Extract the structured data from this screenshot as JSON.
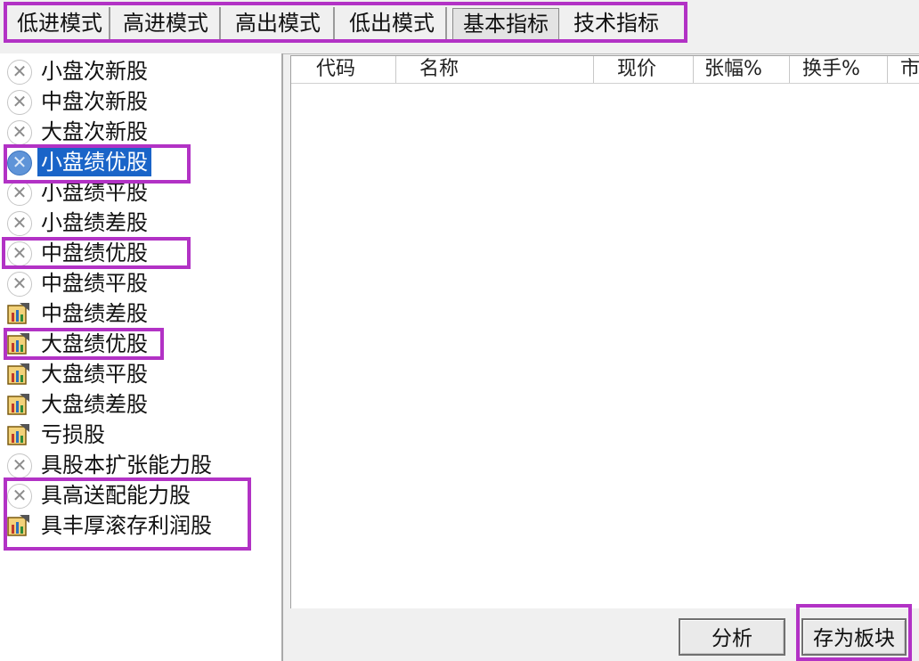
{
  "tabs": [
    {
      "label": "低进模式"
    },
    {
      "label": "高进模式"
    },
    {
      "label": "高出模式"
    },
    {
      "label": "低出模式"
    },
    {
      "label": "基本指标",
      "active": true
    },
    {
      "label": "技术指标"
    }
  ],
  "tree": {
    "items": [
      {
        "label": "小盘次新股",
        "icon": "x-circle-icon"
      },
      {
        "label": "中盘次新股",
        "icon": "x-circle-icon"
      },
      {
        "label": "大盘次新股",
        "icon": "x-circle-icon"
      },
      {
        "label": "小盘绩优股",
        "icon": "x-circle-icon",
        "selected": true
      },
      {
        "label": "小盘绩平股",
        "icon": "x-circle-icon"
      },
      {
        "label": "小盘绩差股",
        "icon": "x-circle-icon"
      },
      {
        "label": "中盘绩优股",
        "icon": "x-circle-icon"
      },
      {
        "label": "中盘绩平股",
        "icon": "x-circle-icon"
      },
      {
        "label": "中盘绩差股",
        "icon": "chart-doc-icon"
      },
      {
        "label": "大盘绩优股",
        "icon": "chart-doc-icon"
      },
      {
        "label": "大盘绩平股",
        "icon": "chart-doc-icon"
      },
      {
        "label": "大盘绩差股",
        "icon": "chart-doc-icon"
      },
      {
        "label": "亏损股",
        "icon": "chart-doc-icon"
      },
      {
        "label": "具股本扩张能力股",
        "icon": "x-circle-icon"
      },
      {
        "label": "具高送配能力股",
        "icon": "x-circle-icon"
      },
      {
        "label": "具丰厚滚存利润股",
        "icon": "chart-doc-icon"
      }
    ]
  },
  "table": {
    "columns": [
      "代码",
      "名称",
      "现价",
      "张幅%",
      "换手%",
      "市"
    ]
  },
  "buttons": {
    "analyze": "分析",
    "save_as_block": "存为板块"
  },
  "colors": {
    "highlight": "#b232c5",
    "selection": "#1a64c8"
  }
}
